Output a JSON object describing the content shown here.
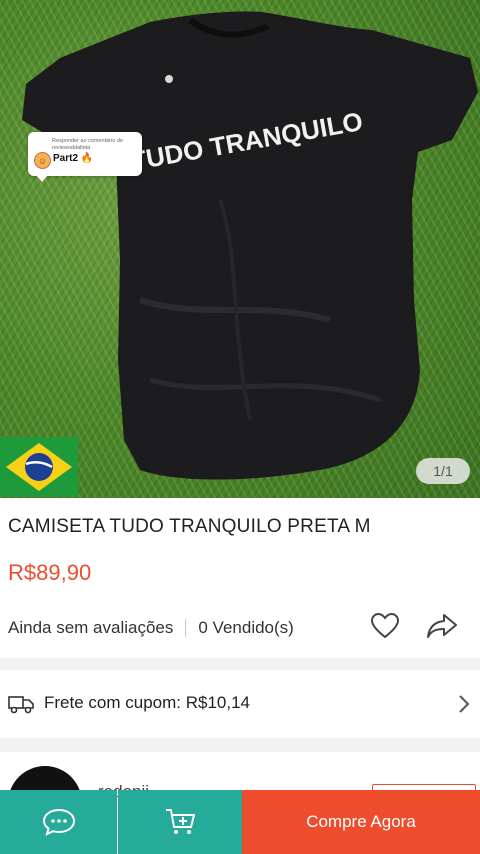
{
  "hero": {
    "shirt_print": "TUDO TRANQUILO",
    "image_counter": "1/1",
    "reply_badge": {
      "small_text": "Responder ao comentário de reviewoddalleta",
      "main_text": "Part2 🔥"
    }
  },
  "product": {
    "title": "CAMISETA TUDO TRANQUILO PRETA M",
    "price": "R$89,90",
    "ratings_text": "Ainda sem avaliações",
    "sold_text": "0 Vendido(s)"
  },
  "shipping": {
    "text": "Frete com cupom: R$10,14"
  },
  "seller": {
    "name_partial": "redenji"
  },
  "bottom_bar": {
    "buy_label": "Compre Agora"
  },
  "colors": {
    "accent": "#ee4d2d",
    "teal": "#26aa99"
  },
  "icons": [
    "heart-icon",
    "share-icon",
    "truck-icon",
    "chevron-right-icon",
    "chat-icon",
    "add-to-cart-icon",
    "brazil-flag-icon"
  ]
}
